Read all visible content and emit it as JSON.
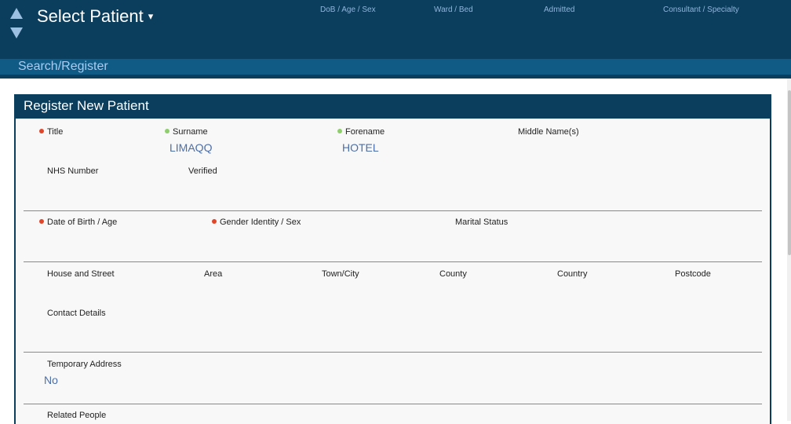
{
  "header": {
    "select_patient_label": "Select Patient",
    "caret_glyph": "▾",
    "columns": {
      "dob_age_sex": "DoB / Age / Sex",
      "ward_bed": "Ward / Bed",
      "admitted": "Admitted",
      "consultant_specialty": "Consultant / Specialty"
    }
  },
  "subnav": {
    "search_register": "Search/Register"
  },
  "form": {
    "title": "Register New Patient",
    "fields": {
      "title_label": "Title",
      "surname_label": "Surname",
      "surname_value": "LIMAQQ",
      "forename_label": "Forename",
      "forename_value": "HOTEL",
      "middle_names_label": "Middle Name(s)",
      "nhs_number_label": "NHS Number",
      "verified_label": "Verified",
      "dob_age_label": "Date of Birth / Age",
      "gender_label": "Gender Identity / Sex",
      "marital_status_label": "Marital Status",
      "house_street_label": "House and Street",
      "area_label": "Area",
      "town_city_label": "Town/City",
      "county_label": "County",
      "country_label": "Country",
      "postcode_label": "Postcode",
      "contact_details_label": "Contact Details",
      "temporary_address_label": "Temporary Address",
      "temporary_address_value": "No",
      "related_people_label": "Related People"
    }
  },
  "colors": {
    "header_bg": "#0b3d5c",
    "subnav_bg": "#0f5b86",
    "value_text": "#4d6fa8",
    "required_dot": "#e0472a",
    "completed_dot": "#8fce6c"
  }
}
